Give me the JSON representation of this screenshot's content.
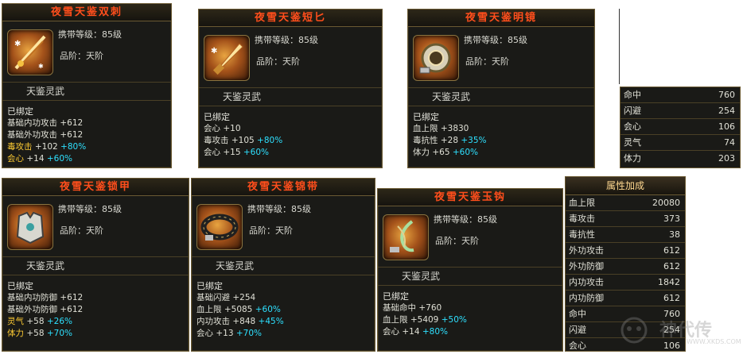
{
  "cards": [
    {
      "title": "夜雪天鉴双刺",
      "req": "携带等级：85级",
      "grade": "品阶：天阶",
      "suit": "天鉴灵武",
      "icon": "twin-dagger-icon",
      "bound": "已绑定",
      "stats": [
        {
          "label": "基础内功攻击",
          "value": "+612",
          "pct": ""
        },
        {
          "label": "基础外功攻击",
          "value": "+612",
          "pct": ""
        },
        {
          "label": "毒攻击",
          "value": "+102",
          "pct": "+80%"
        },
        {
          "label": "会心",
          "value": "+14",
          "pct": "+60%"
        }
      ]
    },
    {
      "title": "夜雪天鉴短匕",
      "req": "携带等级：85级",
      "grade": "品阶：天阶",
      "suit": "天鉴灵武",
      "icon": "short-dagger-icon",
      "bound": "已绑定",
      "stats": [
        {
          "label": "会心",
          "value": "+10",
          "pct": ""
        },
        {
          "label": "毒攻击",
          "value": "+105",
          "pct": "+80%"
        },
        {
          "label": "会心",
          "value": "+15",
          "pct": "+60%"
        }
      ]
    },
    {
      "title": "夜雪天鉴明镜",
      "req": "携带等级：85级",
      "grade": "品阶：天阶",
      "suit": "天鉴灵武",
      "icon": "mirror-icon",
      "bound": "已绑定",
      "stats": [
        {
          "label": "血上限",
          "value": "+3830",
          "pct": ""
        },
        {
          "label": "毒抗性",
          "value": "+28",
          "pct": "+35%"
        },
        {
          "label": "体力",
          "value": "+65",
          "pct": "+60%"
        }
      ]
    },
    {
      "title": "夜雪天鉴锁甲",
      "req": "携带等级：85级",
      "grade": "品阶：天阶",
      "suit": "天鉴灵武",
      "icon": "armor-icon",
      "bound": "已绑定",
      "stats": [
        {
          "label": "基础内功防御",
          "value": "+612",
          "pct": ""
        },
        {
          "label": "基础外功防御",
          "value": "+612",
          "pct": ""
        },
        {
          "label": "灵气",
          "value": "+58",
          "pct": "+26%"
        },
        {
          "label": "体力",
          "value": "+58",
          "pct": "+70%"
        }
      ]
    },
    {
      "title": "夜雪天鉴锦带",
      "req": "携带等级：85级",
      "grade": "品阶：天阶",
      "suit": "天鉴灵武",
      "icon": "belt-icon",
      "bound": "已绑定",
      "stats": [
        {
          "label": "基础闪避",
          "value": "+254",
          "pct": ""
        },
        {
          "label": "血上限",
          "value": "+5085",
          "pct": "+60%"
        },
        {
          "label": "内功攻击",
          "value": "+848",
          "pct": "+45%"
        },
        {
          "label": "会心",
          "value": "+13",
          "pct": "+70%"
        }
      ]
    },
    {
      "title": "夜雪天鉴玉钩",
      "req": "携带等级：85级",
      "grade": "品阶：天阶",
      "suit": "天鉴灵武",
      "icon": "jade-hook-icon",
      "bound": "已绑定",
      "stats": [
        {
          "label": "基础命中",
          "value": "+760",
          "pct": ""
        },
        {
          "label": "血上限",
          "value": "+5409",
          "pct": "+50%"
        },
        {
          "label": "会心",
          "value": "+14",
          "pct": "+80%"
        }
      ]
    }
  ],
  "small_table": [
    {
      "label": "命中",
      "value": "760"
    },
    {
      "label": "闪避",
      "value": "254"
    },
    {
      "label": "会心",
      "value": "106"
    },
    {
      "label": "灵气",
      "value": "74"
    },
    {
      "label": "体力",
      "value": "203"
    }
  ],
  "attr_table": {
    "title": "属性加成",
    "rows": [
      {
        "label": "血上限",
        "value": "20080"
      },
      {
        "label": "毒攻击",
        "value": "373"
      },
      {
        "label": "毒抗性",
        "value": "38"
      },
      {
        "label": "外功攻击",
        "value": "612"
      },
      {
        "label": "外功防御",
        "value": "612"
      },
      {
        "label": "内功攻击",
        "value": "1842"
      },
      {
        "label": "内功防御",
        "value": "612"
      },
      {
        "label": "命中",
        "value": "760"
      },
      {
        "label": "闪避",
        "value": "254"
      },
      {
        "label": "会心",
        "value": "106"
      }
    ]
  },
  "watermark": {
    "text": "神代传",
    "url": "WWW.XKDS.COM"
  }
}
